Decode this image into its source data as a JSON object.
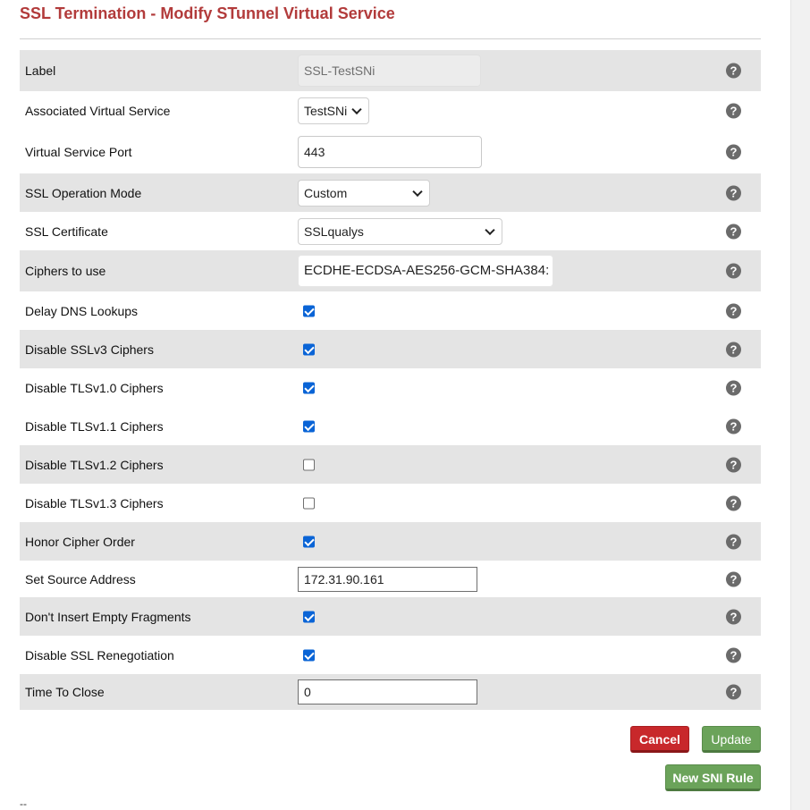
{
  "page": {
    "title": "SSL Termination - Modify STunnel Virtual Service",
    "footer_text": "--"
  },
  "icons": {
    "help": "question-circle-icon",
    "help_glyph": "?"
  },
  "form": {
    "label": {
      "label": "Label",
      "value": "SSL-TestSNi"
    },
    "associated_vs": {
      "label": "Associated Virtual Service",
      "value": "TestSNi"
    },
    "port": {
      "label": "Virtual Service Port",
      "value": "443"
    },
    "ssl_mode": {
      "label": "SSL Operation Mode",
      "value": "Custom"
    },
    "ssl_cert": {
      "label": "SSL Certificate",
      "value": "SSLqualys"
    },
    "ciphers": {
      "label": "Ciphers to use",
      "value": "ECDHE-ECDSA-AES256-GCM-SHA384:"
    },
    "delay_dns": {
      "label": "Delay DNS Lookups",
      "checked": true
    },
    "disable_sslv3": {
      "label": "Disable SSLv3 Ciphers",
      "checked": true
    },
    "disable_tls10": {
      "label": "Disable TLSv1.0 Ciphers",
      "checked": true
    },
    "disable_tls11": {
      "label": "Disable TLSv1.1 Ciphers",
      "checked": true
    },
    "disable_tls12": {
      "label": "Disable TLSv1.2 Ciphers",
      "checked": false
    },
    "disable_tls13": {
      "label": "Disable TLSv1.3 Ciphers",
      "checked": false
    },
    "honor_cipher_order": {
      "label": "Honor Cipher Order",
      "checked": true
    },
    "source_address": {
      "label": "Set Source Address",
      "value": "172.31.90.161"
    },
    "empty_fragments": {
      "label": "Don't Insert Empty Fragments",
      "checked": true
    },
    "disable_reneg": {
      "label": "Disable SSL Renegotiation",
      "checked": true
    },
    "time_to_close": {
      "label": "Time To Close",
      "value": "0"
    }
  },
  "buttons": {
    "cancel": "Cancel",
    "update": "Update",
    "new_sni_rule": "New SNI Rule"
  },
  "colors": {
    "title": "#b23b3b",
    "cancel_button": "#c8282b",
    "update_button": "#6ba35a",
    "checkbox_checked": "#0a64d6",
    "shaded_row": "#e4e4e4"
  }
}
